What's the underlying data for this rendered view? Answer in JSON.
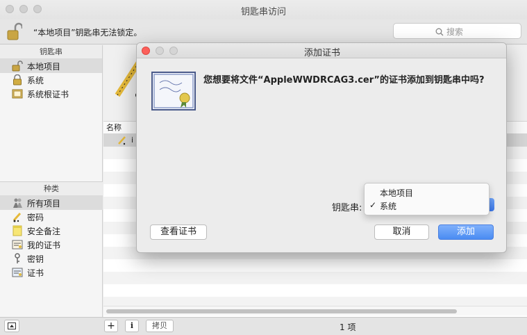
{
  "window": {
    "title": "钥匙串访问"
  },
  "toolbar": {
    "lock_message": "“本地项目”钥匙串无法锁定。",
    "search_placeholder": "搜索"
  },
  "sidebar": {
    "keychains_header": "钥匙串",
    "keychains": [
      {
        "label": "本地项目",
        "icon": "open-lock-icon",
        "selected": true
      },
      {
        "label": "系统",
        "icon": "lock-icon",
        "selected": false
      },
      {
        "label": "系统根证书",
        "icon": "cabinet-icon",
        "selected": false
      }
    ],
    "category_header": "种类",
    "categories": [
      {
        "label": "所有项目",
        "icon": "people-icon",
        "selected": true
      },
      {
        "label": "密码",
        "icon": "pencil-icon",
        "selected": false
      },
      {
        "label": "安全备注",
        "icon": "note-icon",
        "selected": false
      },
      {
        "label": "我的证书",
        "icon": "certificate-icon",
        "selected": false
      },
      {
        "label": "密钥",
        "icon": "key-icon",
        "selected": false
      },
      {
        "label": "证书",
        "icon": "certificate-icon",
        "selected": false
      }
    ]
  },
  "list": {
    "name_column": "名称",
    "first_item": "i"
  },
  "bottombar": {
    "add_label": "+",
    "info_label": "i",
    "copy_label": "拷贝",
    "count": "1 项"
  },
  "dialog": {
    "title": "添加证书",
    "question": "您想要将文件“AppleWWDRCAG3.cer”的证书添加到钥匙串中吗?",
    "keychain_label": "钥匙串:",
    "popup_options": [
      "本地项目",
      "系统"
    ],
    "popup_selected": "系统",
    "popup_check": "✓",
    "view_cert_button": "查看证书",
    "cancel_button": "取消",
    "add_button": "添加",
    "accent_color": "#4a8cf2"
  }
}
